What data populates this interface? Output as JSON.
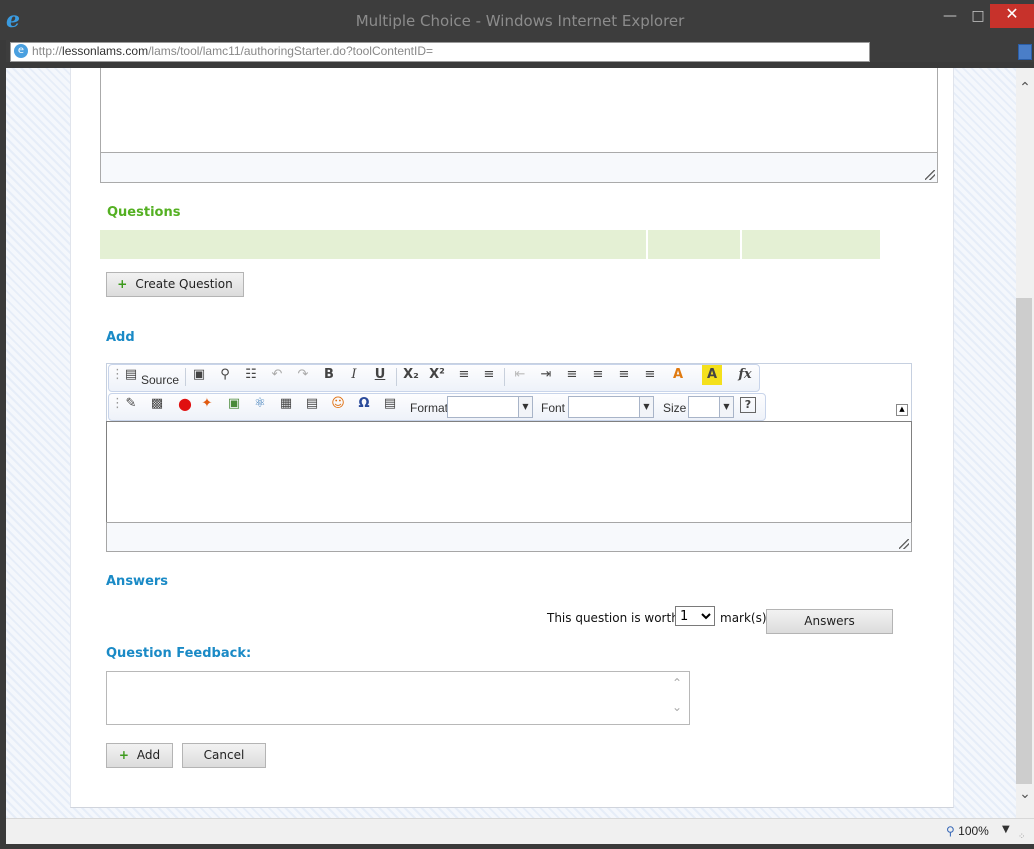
{
  "window": {
    "title": "Multiple Choice - Windows Internet Explorer",
    "url_prefix": "http://",
    "url_domain": "lessonlams.com",
    "url_path": "/lams/tool/lamc11/authoringStarter.do?toolContentID="
  },
  "status": {
    "zoom": "100%"
  },
  "sections": {
    "questions": "Questions",
    "add": "Add",
    "answers": "Answers",
    "feedback": "Question Feedback:"
  },
  "buttons": {
    "create_question": "Create Question",
    "answers": "Answers",
    "add": "Add",
    "cancel": "Cancel"
  },
  "editor": {
    "source_label": "Source",
    "format_label": "Format",
    "font_label": "Font",
    "size_label": "Size"
  },
  "marks": {
    "worth_label": "This question is worth",
    "value": "1",
    "unit_label": "mark(s)"
  },
  "icons": [
    "ie-logo-icon",
    "minimize-icon",
    "maximize-icon",
    "close-icon",
    "globe-icon",
    "page-icon",
    "zoom-icon"
  ]
}
